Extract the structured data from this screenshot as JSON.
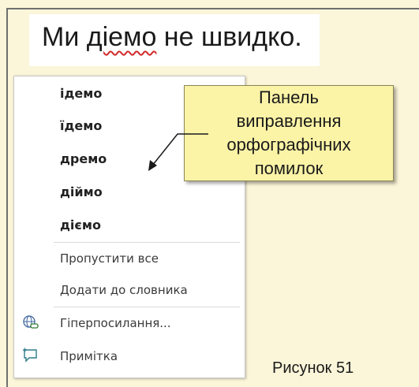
{
  "sentence": {
    "part1": "Ми ",
    "misspelled_word": "дiемо",
    "part2": " не швидко."
  },
  "context_menu": {
    "suggestions": [
      "ідемо",
      "їдемо",
      "дремо",
      "діймо",
      "діємо"
    ],
    "ignore_all": "Пропустити все",
    "add_to_dictionary": "Додати до словника",
    "hyperlink": "Гіперпосилання...",
    "comment": "Примітка",
    "icons": {
      "hyperlink": "globe-link-icon",
      "comment": "comment-icon"
    }
  },
  "callout": {
    "lines": [
      "Панель",
      "виправлення",
      "орфографічних",
      "помилок"
    ]
  },
  "figure_label": "Рисунок 51",
  "colors": {
    "background": "#fbf5d9",
    "callout_fill": "#fbf3a6",
    "misspelling_underline": "#d22a2a"
  }
}
